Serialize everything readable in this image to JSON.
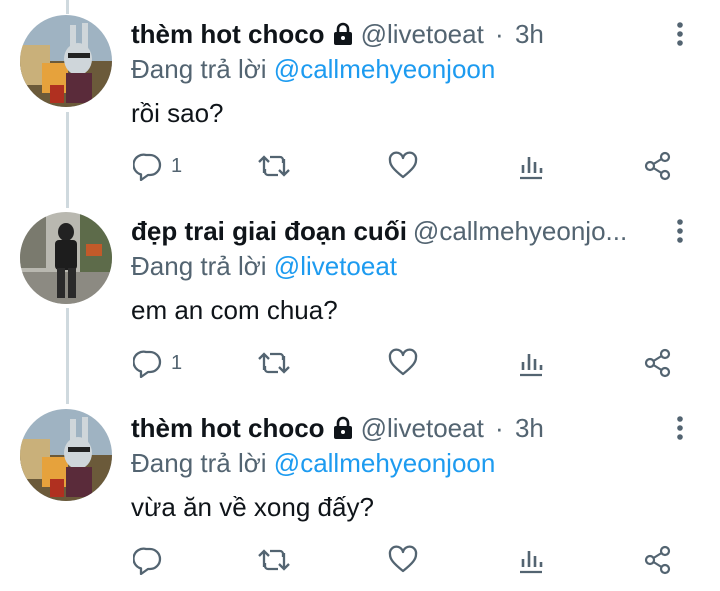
{
  "tweets": [
    {
      "name": "thèm hot choco",
      "handle": "@livetoeat",
      "separator": "·",
      "time": "3h",
      "replying_prefix": "Đang trả lời",
      "replying_to": "@callmehyeonjoon",
      "text": "rồi sao?",
      "reply_count": "1",
      "retweet_count": "",
      "protected": true,
      "avatar": "bugs-bunny-avatar"
    },
    {
      "name": "đẹp trai giai đoạn cuối",
      "handle": "@callmehyeonjo...",
      "separator": "",
      "time": "",
      "replying_prefix": "Đang trả lời",
      "replying_to": "@livetoeat",
      "text": "em an com chua?",
      "reply_count": "1",
      "retweet_count": "",
      "protected": false,
      "avatar": "street-photo-avatar"
    },
    {
      "name": "thèm hot choco",
      "handle": "@livetoeat",
      "separator": "·",
      "time": "3h",
      "replying_prefix": "Đang trả lời",
      "replying_to": "@callmehyeonjoon",
      "text": "vừa ăn về xong đấy?",
      "reply_count": "",
      "retweet_count": "",
      "protected": true,
      "avatar": "bugs-bunny-avatar"
    }
  ],
  "colors": {
    "accent": "#1d9bf0",
    "secondary_text": "#536471",
    "thread_line": "#cfd9de"
  },
  "icons": [
    "reply-icon",
    "retweet-icon",
    "like-icon",
    "views-icon",
    "share-icon",
    "more-icon",
    "lock-icon"
  ]
}
